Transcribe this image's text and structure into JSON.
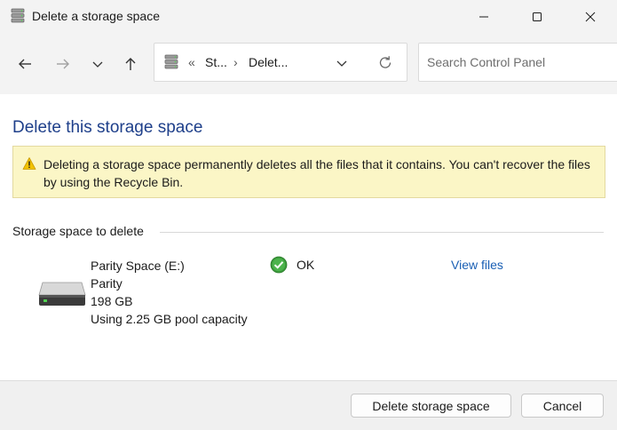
{
  "window": {
    "title": "Delete a storage space",
    "app_icon": "storage-spaces-icon"
  },
  "nav": {
    "back_icon": "arrow-left-icon",
    "forward_icon": "arrow-right-icon",
    "recent_icon": "chevron-down-icon",
    "up_icon": "arrow-up-icon",
    "address": {
      "overflow": "«",
      "segment1": "St...",
      "separator": "›",
      "segment2": "Delet..."
    },
    "search_placeholder": "Search Control Panel"
  },
  "main": {
    "title": "Delete this storage space",
    "warning_text": "Deleting a storage space permanently deletes all the files that it contains. You can't recover the files by using the Recycle Bin.",
    "section_label": "Storage space to delete",
    "storage": {
      "name": "Parity Space (E:)",
      "resiliency": "Parity",
      "size": "198 GB",
      "usage": "Using 2.25 GB pool capacity",
      "status": "OK",
      "view_files": "View files"
    }
  },
  "footer": {
    "delete_label": "Delete storage space",
    "cancel_label": "Cancel"
  },
  "colors": {
    "title_blue": "#1e3f8a",
    "link_blue": "#1a5fb4",
    "warning_bg": "#fbf6c6",
    "ok_green": "#3a9a3a"
  }
}
